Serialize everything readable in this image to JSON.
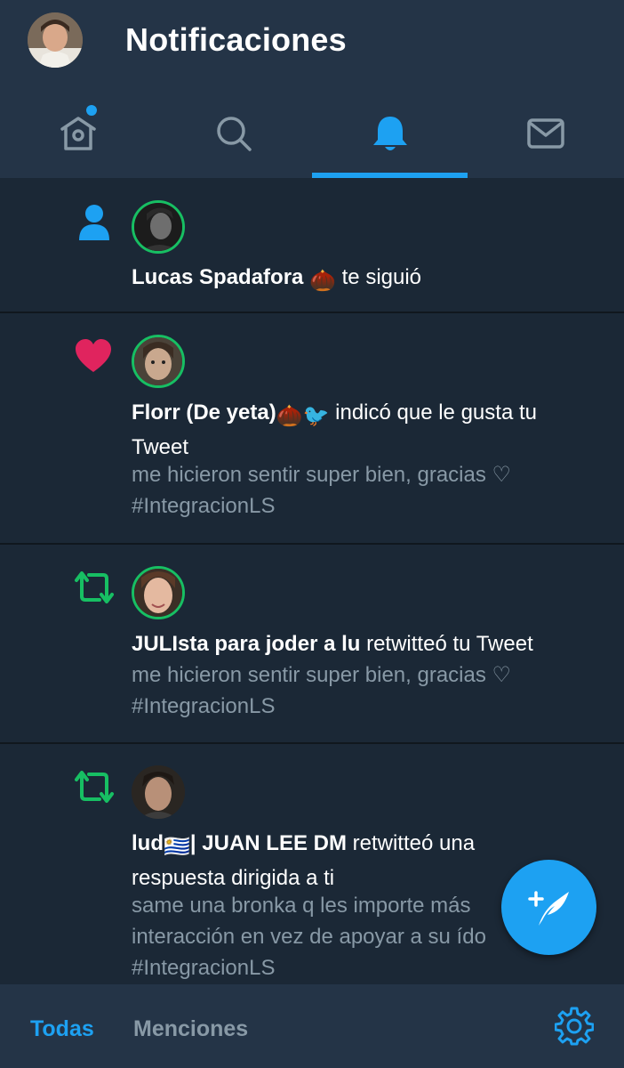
{
  "header": {
    "title": "Notificaciones",
    "avatar_icon": "profile-avatar"
  },
  "tabs": [
    {
      "name": "home",
      "icon": "home-icon",
      "active": false,
      "has_dot": true
    },
    {
      "name": "search",
      "icon": "search-icon",
      "active": false
    },
    {
      "name": "notifications",
      "icon": "bell-icon",
      "active": true
    },
    {
      "name": "messages",
      "icon": "mail-icon",
      "active": false
    }
  ],
  "colors": {
    "accent": "#1da1f2",
    "background": "#1b2836",
    "header": "#243447",
    "retweet": "#17bf63",
    "like": "#e0245e",
    "secondary_text": "#8899a6"
  },
  "notifications": [
    {
      "type": "follow",
      "icon": "person-icon",
      "user": "Lucas Spadafora",
      "user_emoji": "🌰",
      "action": "te siguió",
      "snippet_lines": []
    },
    {
      "type": "like",
      "icon": "heart-icon",
      "user": "Florr (De yeta)",
      "user_emoji": "🌰🐦",
      "action": "indicó que le gusta tu",
      "action_line2": "Tweet",
      "snippet_lines": [
        "me hicieron sentir super bien, gracias ♡",
        "#IntegracionLS"
      ]
    },
    {
      "type": "retweet",
      "icon": "retweet-icon",
      "user": "JULIsta para joder a lu",
      "action": "retwitteó tu Tweet",
      "snippet_lines": [
        "me hicieron sentir super bien, gracias ♡",
        "#IntegracionLS"
      ]
    },
    {
      "type": "retweet",
      "icon": "retweet-icon",
      "user_prefix": "lud",
      "user_emoji": "🇺🇾",
      "user": "| JUAN LEE DM",
      "action": "retwitteó una",
      "action_line2": "respuesta dirigida a ti",
      "snippet_lines": [
        "same una bronka q les importe más",
        "interacción en vez de apoyar a su ído",
        "#IntegracionLS"
      ]
    }
  ],
  "fab": {
    "icon": "compose-tweet-icon"
  },
  "bottom_bar": {
    "tab_all": "Todas",
    "tab_mentions": "Menciones",
    "settings_icon": "gear-icon"
  }
}
